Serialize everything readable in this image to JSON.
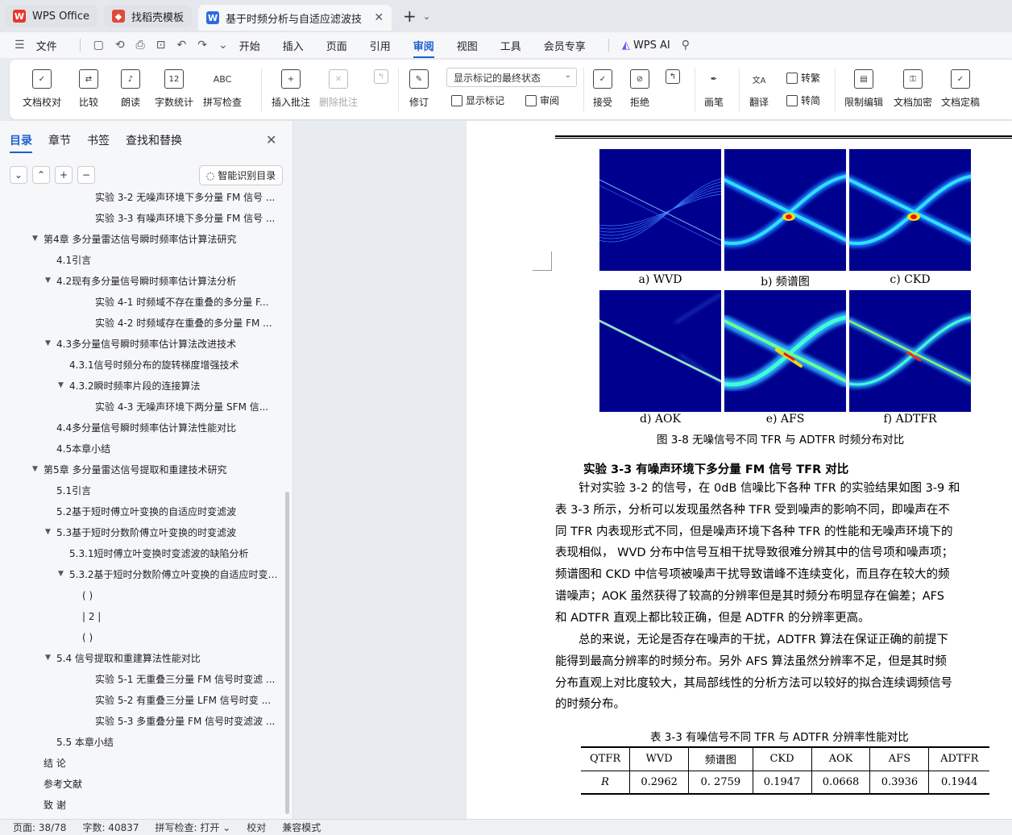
{
  "tabs": [
    {
      "label": "WPS Office",
      "icon": "wps-logo-icon"
    },
    {
      "label": "找稻壳模板",
      "icon": "docer-icon"
    },
    {
      "label": "基于时频分析与自适应滤波技",
      "icon": "word-doc-icon",
      "active": true
    }
  ],
  "menu": {
    "file": "文件",
    "items": [
      "开始",
      "插入",
      "页面",
      "引用",
      "审阅",
      "视图",
      "工具",
      "会员专享"
    ],
    "active": "审阅",
    "wps_ai": "WPS AI"
  },
  "ribbon": {
    "doc_check": "文档校对",
    "compare": "比较",
    "read_aloud": "朗读",
    "word_count": "字数统计",
    "spell_check": "拼写检查",
    "insert_comment": "插入批注",
    "delete_comment": "删除批注",
    "revise": "修订",
    "markup_dropdown": "显示标记的最终状态",
    "show_markup": "显示标记",
    "review": "审阅",
    "accept": "接受",
    "reject": "拒绝",
    "brush": "画笔",
    "translate": "翻译",
    "to_traditional": "转繁",
    "to_simplified": "转简",
    "restrict_edit": "限制编辑",
    "encrypt": "文档加密",
    "finalize": "文档定稿",
    "count_icon_text": "12",
    "spell_icon_text": "ABC"
  },
  "nav": {
    "tabs": [
      "目录",
      "章节",
      "书签",
      "查找和替换"
    ],
    "active_tab": "目录",
    "smart_button": "智能识别目录",
    "toc": [
      {
        "label": "实验 3-2 无噪声环境下多分量 FM 信号 ...",
        "level": 4,
        "caret": false
      },
      {
        "label": "实验 3-3 有噪声环境下多分量 FM 信号 ...",
        "level": 4,
        "caret": false
      },
      {
        "label": "第4章 多分量雷达信号瞬时频率估计算法研究",
        "level": 1,
        "caret": true
      },
      {
        "label": "4.1引言",
        "level": 2,
        "caret": false
      },
      {
        "label": "4.2现有多分量信号瞬时频率估计算法分析",
        "level": 2,
        "caret": true
      },
      {
        "label": "实验 4-1 时频域不存在重叠的多分量 F...",
        "level": 4,
        "caret": false
      },
      {
        "label": "实验 4-2 时频域存在重叠的多分量 FM ...",
        "level": 4,
        "caret": false
      },
      {
        "label": "4.3多分量信号瞬时频率估计算法改进技术",
        "level": 2,
        "caret": true
      },
      {
        "label": "4.3.1信号时频分布的旋转梯度增强技术",
        "level": 3,
        "caret": false
      },
      {
        "label": "4.3.2瞬时频率片段的连接算法",
        "level": 3,
        "caret": true
      },
      {
        "label": "实验 4-3 无噪声环境下两分量 SFM 信...",
        "level": 4,
        "caret": false
      },
      {
        "label": "4.4多分量信号瞬时频率估计算法性能对比",
        "level": 2,
        "caret": false
      },
      {
        "label": "4.5本章小结",
        "level": 2,
        "caret": false
      },
      {
        "label": "第5章 多分量雷达信号提取和重建技术研究",
        "level": 1,
        "caret": true
      },
      {
        "label": "5.1引言",
        "level": 2,
        "caret": false
      },
      {
        "label": "5.2基于短时傅立叶变换的自适应时变滤波",
        "level": 2,
        "caret": false
      },
      {
        "label": "5.3基于短时分数阶傅立叶变换的时变滤波",
        "level": 2,
        "caret": true
      },
      {
        "label": "5.3.1短时傅立叶变换时变滤波的缺陷分析",
        "level": 3,
        "caret": false
      },
      {
        "label": "5.3.2基于短时分数阶傅立叶变换的自适应时变 ...",
        "level": 3,
        "caret": true
      },
      {
        "label": "( )",
        "level": 5,
        "caret": false
      },
      {
        "label": "| 2 |",
        "level": 5,
        "caret": false
      },
      {
        "label": "( )",
        "level": 5,
        "caret": false
      },
      {
        "label": "5.4 信号提取和重建算法性能对比",
        "level": 2,
        "caret": true
      },
      {
        "label": "实验 5-1 无重叠三分量 FM 信号时变滤 ...",
        "level": 4,
        "caret": false
      },
      {
        "label": "实验 5-2 有重叠三分量 LFM 信号时变 ...",
        "level": 4,
        "caret": false
      },
      {
        "label": "实验 5-3 多重叠分量 FM 信号时变滤波 ...",
        "level": 4,
        "caret": false
      },
      {
        "label": "5.5 本章小结",
        "level": 2,
        "caret": false
      },
      {
        "label": "结 论",
        "level": 1,
        "caret": false
      },
      {
        "label": "参考文献",
        "level": 1,
        "caret": false
      },
      {
        "label": "致 谢",
        "level": 1,
        "caret": false
      }
    ]
  },
  "doc": {
    "panels": [
      {
        "caption": "a) WVD",
        "kind": "wvd"
      },
      {
        "caption": "b) 频谱图",
        "kind": "spec"
      },
      {
        "caption": "c) CKD",
        "kind": "spec"
      },
      {
        "caption": "d)  AOK",
        "kind": "aok"
      },
      {
        "caption": "e)  AFS",
        "kind": "afs"
      },
      {
        "caption": "f) ADTFR",
        "kind": "adtfr"
      }
    ],
    "figure_caption": "图 3-8 无噪信号不同  TFR 与  ADTFR 时频分布对比",
    "heading": "实验 3-3 有噪声环境下多分量 FM 信号 TFR 对比",
    "para1": [
      "针对实验  3-2 的信号，在  0dB 信噪比下各种  TFR 的实验结果如图  3-9 和",
      "表  3-3 所示，分析可以发现虽然各种  TFR 受到噪声的影响不同，即噪声在不",
      "同  TFR 内表现形式不同，但是噪声环境下各种  TFR 的性能和无噪声环境下的",
      "表现相似， WVD 分布中信号互相干扰导致很难分辨其中的信号项和噪声项；",
      "频谱图和  CKD 中信号项被噪声干扰导致谱峰不连续变化，而且存在较大的频",
      "谱噪声；AOK 虽然获得了较高的分辨率但是其时频分布明显存在偏差；AFS",
      "和 ADTFR 直观上都比较正确，但是  ADTFR 的分辨率更高。"
    ],
    "para2": [
      "总的来说，无论是否存在噪声的干扰，ADTFR 算法在保证正确的前提下",
      "能得到最高分辨率的时频分布。另外  AFS 算法虽然分辨率不足，但是其时频",
      "分布直观上对比度较大，其局部线性的分析方法可以较好的拟合连续调频信号",
      "的时频分布。"
    ],
    "table_caption": "表  3-3 有噪信号不同  TFR 与  ADTFR 分辨率性能对比",
    "table": {
      "headers": [
        "QTFR",
        "WVD",
        "频谱图",
        "CKD",
        "AOK",
        "AFS",
        "ADTFR"
      ],
      "rows": [
        [
          "R",
          "0.2962",
          "0. 2759",
          "0.1947",
          "0.0668",
          "0.3936",
          "0.1944"
        ]
      ]
    }
  },
  "status": {
    "page": "页面: 38/78",
    "words": "字数: 40837",
    "spell": "拼写检查: 打开",
    "proof": "校对",
    "compat": "兼容模式"
  },
  "colors": {
    "accent": "#1e5fd0",
    "wps_red": "#e8362c",
    "heat_bg": "#00008f"
  }
}
